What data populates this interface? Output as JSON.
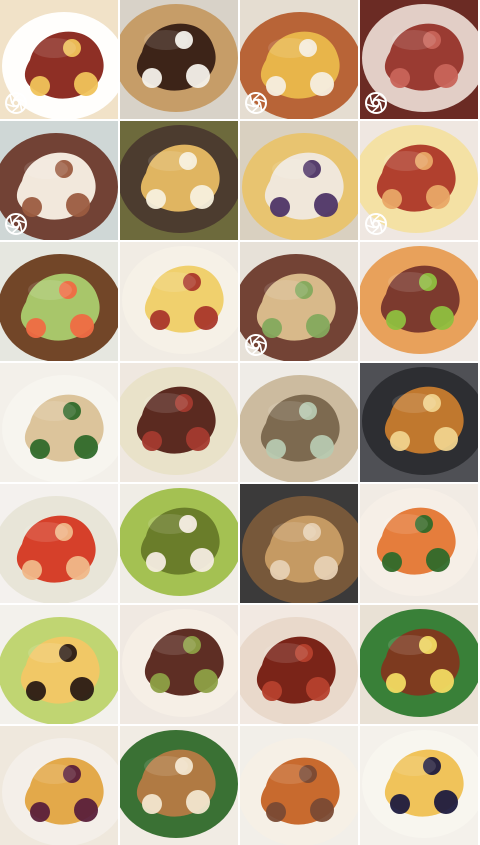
{
  "gallery": {
    "items": [
      {
        "icon": "steak-cake-photo",
        "live": true,
        "bg": "#f1e2c8",
        "a": "#8e2f25",
        "b": "#f0c35a",
        "c": "#ffffff"
      },
      {
        "icon": "brownie-bowl-photo",
        "live": false,
        "bg": "#d8d2c8",
        "a": "#3d2418",
        "b": "#f4f1ea",
        "c": "#c59a63"
      },
      {
        "icon": "pudding-cake-photo",
        "live": true,
        "bg": "#e5ddd1",
        "a": "#e8b54a",
        "b": "#f6eedf",
        "c": "#b55d2e"
      },
      {
        "icon": "sliced-beef-photo",
        "live": true,
        "bg": "#6b2b24",
        "a": "#9a3b32",
        "b": "#c8645a",
        "c": "#e9d7d0"
      },
      {
        "icon": "eggs-cakes-photo",
        "live": true,
        "bg": "#cfd7d6",
        "a": "#f2e8dc",
        "b": "#9b5c40",
        "c": "#6d3a2c"
      },
      {
        "icon": "crepe-table-photo",
        "live": false,
        "bg": "#6d6a3c",
        "a": "#e0b561",
        "b": "#f7f0dd",
        "c": "#4b3a2e"
      },
      {
        "icon": "dumpling-dishes-photo",
        "live": false,
        "bg": "#d9d0c0",
        "a": "#f0e7da",
        "b": "#4e3567",
        "c": "#e9c36b"
      },
      {
        "icon": "bacon-shrimp-photo",
        "live": true,
        "bg": "#efe7e1",
        "a": "#b1402e",
        "b": "#e9a867",
        "c": "#f3e0a0"
      },
      {
        "icon": "kiwi-salmon-photo",
        "live": false,
        "bg": "#e6e7e0",
        "a": "#a8c66a",
        "b": "#ef6b43",
        "c": "#6c3d1e"
      },
      {
        "icon": "crepe-sausage-photo",
        "live": false,
        "bg": "#f1ece4",
        "a": "#f0d06d",
        "b": "#a9372b",
        "c": "#f6f1e7"
      },
      {
        "icon": "dumplings-cucumber-photo",
        "live": true,
        "bg": "#e7e1d8",
        "a": "#d8b98a",
        "b": "#84a95d",
        "c": "#6d3a2c"
      },
      {
        "icon": "steak-grapes-photo",
        "live": false,
        "bg": "#efe9e4",
        "a": "#7c3a2e",
        "b": "#8fbf3f",
        "c": "#e79d53"
      },
      {
        "icon": "dumplings-greens-photo",
        "live": false,
        "bg": "#f3f0ea",
        "a": "#dcc49b",
        "b": "#2f6a2a",
        "c": "#f7f4ef"
      },
      {
        "icon": "pancake-sausage-photo",
        "live": false,
        "bg": "#efe8e0",
        "a": "#5b2a20",
        "b": "#a43a2f",
        "c": "#e8e1c7"
      },
      {
        "icon": "wonton-soup-photo",
        "live": false,
        "bg": "#efece7",
        "a": "#7d6a50",
        "b": "#b7c9b0",
        "c": "#c9b89b"
      },
      {
        "icon": "glazed-omelette-photo",
        "live": false,
        "bg": "#4f5055",
        "a": "#c0782e",
        "b": "#f0d38d",
        "c": "#2b2c30"
      },
      {
        "icon": "tomato-soup-photo",
        "live": false,
        "bg": "#f4f1ee",
        "a": "#d6402a",
        "b": "#f0b889",
        "c": "#e7e4d6"
      },
      {
        "icon": "kiwi-bread-photo",
        "live": false,
        "bg": "#f0ede6",
        "a": "#6a7d2a",
        "b": "#f4ece0",
        "c": "#9fbf4a"
      },
      {
        "icon": "fried-noodles-photo",
        "live": false,
        "bg": "#3b3a3a",
        "a": "#c59a63",
        "b": "#e7d1b4",
        "c": "#7a5a3a"
      },
      {
        "icon": "shrimp-pepper-photo",
        "live": false,
        "bg": "#f1ebe4",
        "a": "#e57d3c",
        "b": "#2f6a2a",
        "c": "#f5efe7"
      },
      {
        "icon": "pudding-grapes-photo",
        "live": false,
        "bg": "#f3f1ec",
        "a": "#f1c866",
        "b": "#2a1b14",
        "c": "#bdd36c"
      },
      {
        "icon": "sliced-steak-photo",
        "live": false,
        "bg": "#f0e9e2",
        "a": "#5e2e24",
        "b": "#8da046",
        "c": "#f6efe6"
      },
      {
        "icon": "braised-meat-photo",
        "live": false,
        "bg": "#f2e9e2",
        "a": "#7a2418",
        "b": "#b6412d",
        "c": "#e8d8c9"
      },
      {
        "icon": "eel-egg-photo",
        "live": false,
        "bg": "#e9e1d5",
        "a": "#7d3a1f",
        "b": "#f2da62",
        "c": "#2f7a2f"
      },
      {
        "icon": "pancake-plum-photo",
        "live": false,
        "bg": "#efe8dd",
        "a": "#e3a94a",
        "b": "#5a1f3a",
        "c": "#f3efe9"
      },
      {
        "icon": "roll-cake-photo",
        "live": false,
        "bg": "#f1ece4",
        "a": "#b07a43",
        "b": "#f2e6cf",
        "c": "#2f6a2a"
      },
      {
        "icon": "sweet-potato-photo",
        "live": false,
        "bg": "#f2efe9",
        "a": "#c86a2e",
        "b": "#7a4a34",
        "c": "#f5efe6"
      },
      {
        "icon": "crepe-blueberry-photo",
        "live": false,
        "bg": "#f4f1eb",
        "a": "#f0c35a",
        "b": "#1e1b3f",
        "c": "#f8f5ef"
      }
    ]
  }
}
